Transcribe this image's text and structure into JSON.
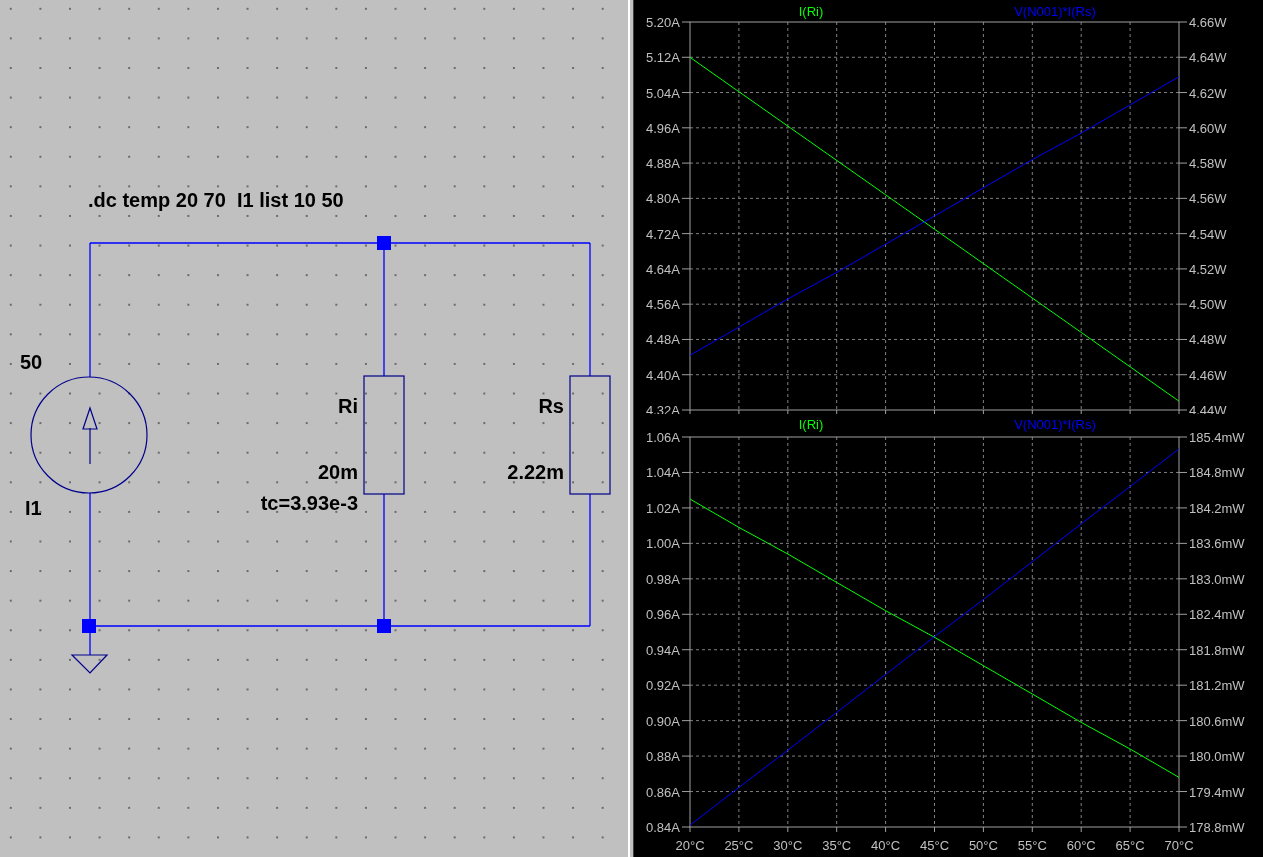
{
  "schematic": {
    "directive": ".dc temp 20 70  I1 list 10 50",
    "current_source": {
      "value": "50",
      "name": "I1"
    },
    "resistors": [
      {
        "name": "Ri",
        "value": "20m",
        "tc": "tc=3.93e-3"
      },
      {
        "name": "Rs",
        "value": "2.22m"
      }
    ]
  },
  "plots": [
    {
      "chart_data": {
        "type": "line",
        "grid": true,
        "x": [
          20,
          25,
          30,
          35,
          40,
          45,
          50,
          55,
          60,
          65,
          70
        ],
        "xlim": [
          20,
          70
        ],
        "ylim": [
          4.32,
          5.2
        ],
        "yticks": [
          {
            "value": 5.2,
            "label": "5.20A"
          },
          {
            "value": 5.12,
            "label": "5.12A"
          },
          {
            "value": 5.04,
            "label": "5.04A"
          },
          {
            "value": 4.96,
            "label": "4.96A"
          },
          {
            "value": 4.88,
            "label": "4.88A"
          },
          {
            "value": 4.8,
            "label": "4.80A"
          },
          {
            "value": 4.72,
            "label": "4.72A"
          },
          {
            "value": 4.64,
            "label": "4.64A"
          },
          {
            "value": 4.56,
            "label": "4.56A"
          },
          {
            "value": 4.48,
            "label": "4.48A"
          },
          {
            "value": 4.4,
            "label": "4.40A"
          },
          {
            "value": 4.32,
            "label": "4.32A"
          }
        ],
        "y2lim": [
          4.44,
          4.66
        ],
        "y2ticks": [
          {
            "value": 4.66,
            "label": "4.66W"
          },
          {
            "value": 4.64,
            "label": "4.64W"
          },
          {
            "value": 4.62,
            "label": "4.62W"
          },
          {
            "value": 4.6,
            "label": "4.60W"
          },
          {
            "value": 4.58,
            "label": "4.58W"
          },
          {
            "value": 4.56,
            "label": "4.56W"
          },
          {
            "value": 4.54,
            "label": "4.54W"
          },
          {
            "value": 4.52,
            "label": "4.52W"
          },
          {
            "value": 4.5,
            "label": "4.50W"
          },
          {
            "value": 4.48,
            "label": "4.48W"
          },
          {
            "value": 4.46,
            "label": "4.46W"
          },
          {
            "value": 4.44,
            "label": "4.44W"
          }
        ],
        "series": [
          {
            "name": "I(Ri)",
            "color": "#00ff00",
            "values": [
              5.12,
              5.042,
              4.964,
              4.886,
              4.808,
              4.73,
              4.652,
              4.574,
              4.496,
              4.418,
              4.34
            ]
          },
          {
            "name": "V(N001)*I(Rs)",
            "color": "#0000ff",
            "axis": "y2",
            "values": [
              4.471,
              4.487,
              4.503,
              4.518,
              4.534,
              4.55,
              4.566,
              4.582,
              4.597,
              4.613,
              4.629
            ]
          }
        ]
      }
    },
    {
      "chart_data": {
        "type": "line",
        "grid": true,
        "x": [
          20,
          25,
          30,
          35,
          40,
          45,
          50,
          55,
          60,
          65,
          70
        ],
        "xlim": [
          20,
          70
        ],
        "xticks": [
          {
            "value": 20,
            "label": "20°C"
          },
          {
            "value": 25,
            "label": "25°C"
          },
          {
            "value": 30,
            "label": "30°C"
          },
          {
            "value": 35,
            "label": "35°C"
          },
          {
            "value": 40,
            "label": "40°C"
          },
          {
            "value": 45,
            "label": "45°C"
          },
          {
            "value": 50,
            "label": "50°C"
          },
          {
            "value": 55,
            "label": "55°C"
          },
          {
            "value": 60,
            "label": "60°C"
          },
          {
            "value": 65,
            "label": "65°C"
          },
          {
            "value": 70,
            "label": "70°C"
          }
        ],
        "ylim": [
          0.84,
          1.06
        ],
        "yticks": [
          {
            "value": 1.06,
            "label": "1.06A"
          },
          {
            "value": 1.04,
            "label": "1.04A"
          },
          {
            "value": 1.02,
            "label": "1.02A"
          },
          {
            "value": 1.0,
            "label": "1.00A"
          },
          {
            "value": 0.98,
            "label": "0.98A"
          },
          {
            "value": 0.96,
            "label": "0.96A"
          },
          {
            "value": 0.94,
            "label": "0.94A"
          },
          {
            "value": 0.92,
            "label": "0.92A"
          },
          {
            "value": 0.9,
            "label": "0.90A"
          },
          {
            "value": 0.88,
            "label": "0.88A"
          },
          {
            "value": 0.86,
            "label": "0.86A"
          },
          {
            "value": 0.84,
            "label": "0.84A"
          }
        ],
        "y2lim": [
          178.8,
          185.4
        ],
        "y2ticks": [
          {
            "value": 185.4,
            "label": "185.4mW"
          },
          {
            "value": 184.8,
            "label": "184.8mW"
          },
          {
            "value": 184.2,
            "label": "184.2mW"
          },
          {
            "value": 183.6,
            "label": "183.6mW"
          },
          {
            "value": 183.0,
            "label": "183.0mW"
          },
          {
            "value": 182.4,
            "label": "182.4mW"
          },
          {
            "value": 181.8,
            "label": "181.8mW"
          },
          {
            "value": 181.2,
            "label": "181.2mW"
          },
          {
            "value": 180.6,
            "label": "180.6mW"
          },
          {
            "value": 180.0,
            "label": "180.0mW"
          },
          {
            "value": 179.4,
            "label": "179.4mW"
          },
          {
            "value": 178.8,
            "label": "178.8mW"
          }
        ],
        "series": [
          {
            "name": "I(Ri)",
            "color": "#00ff00",
            "values": [
              1.025,
              1.009,
              0.994,
              0.978,
              0.962,
              0.947,
              0.931,
              0.915,
              0.899,
              0.884,
              0.868
            ]
          },
          {
            "name": "V(N001)*I(Rs)",
            "color": "#0000ff",
            "axis": "y2",
            "values": [
              178.83,
              179.47,
              180.1,
              180.74,
              181.38,
              182.02,
              182.65,
              183.29,
              183.93,
              184.56,
              185.2
            ]
          }
        ]
      }
    }
  ]
}
